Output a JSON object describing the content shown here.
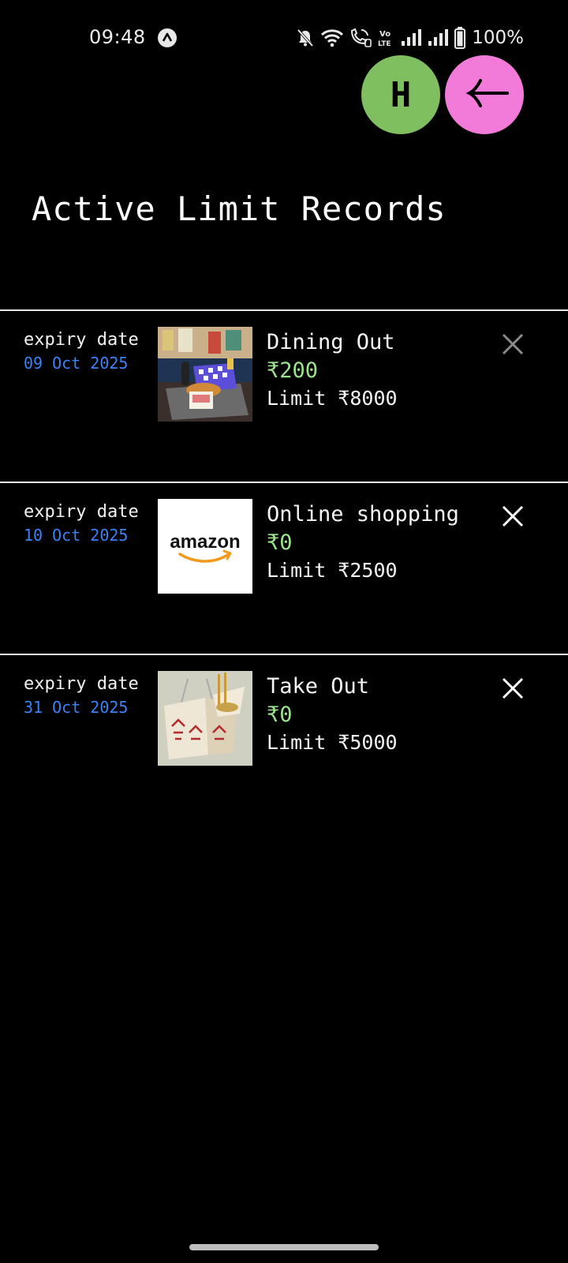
{
  "status_bar": {
    "time": "09:48",
    "battery": "100%",
    "icons": [
      "app-notification-icon",
      "mute-icon",
      "wifi-icon",
      "wifi-calling-icon",
      "volte-icon",
      "signal-icon",
      "signal-icon",
      "battery-icon"
    ]
  },
  "actions": {
    "home_label": "H",
    "home_color": "#7fbf5f",
    "back_color": "#f27ad9",
    "back_icon": "arrow-left-icon"
  },
  "page": {
    "title": "Active Limit Records"
  },
  "records": [
    {
      "expiry_label": "expiry date",
      "expiry_date": "09 Oct 2025",
      "name": "Dining Out",
      "amount": "₹200",
      "limit": "Limit ₹8000",
      "image": "dining-out-photo",
      "close_icon": "close-icon"
    },
    {
      "expiry_label": "expiry date",
      "expiry_date": "10 Oct 2025",
      "name": "Online shopping",
      "amount": "₹0",
      "limit": "Limit ₹2500",
      "image": "amazon-logo",
      "image_text": "amazon",
      "close_icon": "close-icon"
    },
    {
      "expiry_label": "expiry date",
      "expiry_date": "31 Oct 2025",
      "name": "Take Out",
      "amount": "₹0",
      "limit": "Limit ₹5000",
      "image": "takeout-box-photo",
      "close_icon": "close-icon"
    }
  ],
  "colors": {
    "background": "#000000",
    "date": "#3b82f6",
    "amount": "#9be38f",
    "divider": "#e6e6e6"
  }
}
